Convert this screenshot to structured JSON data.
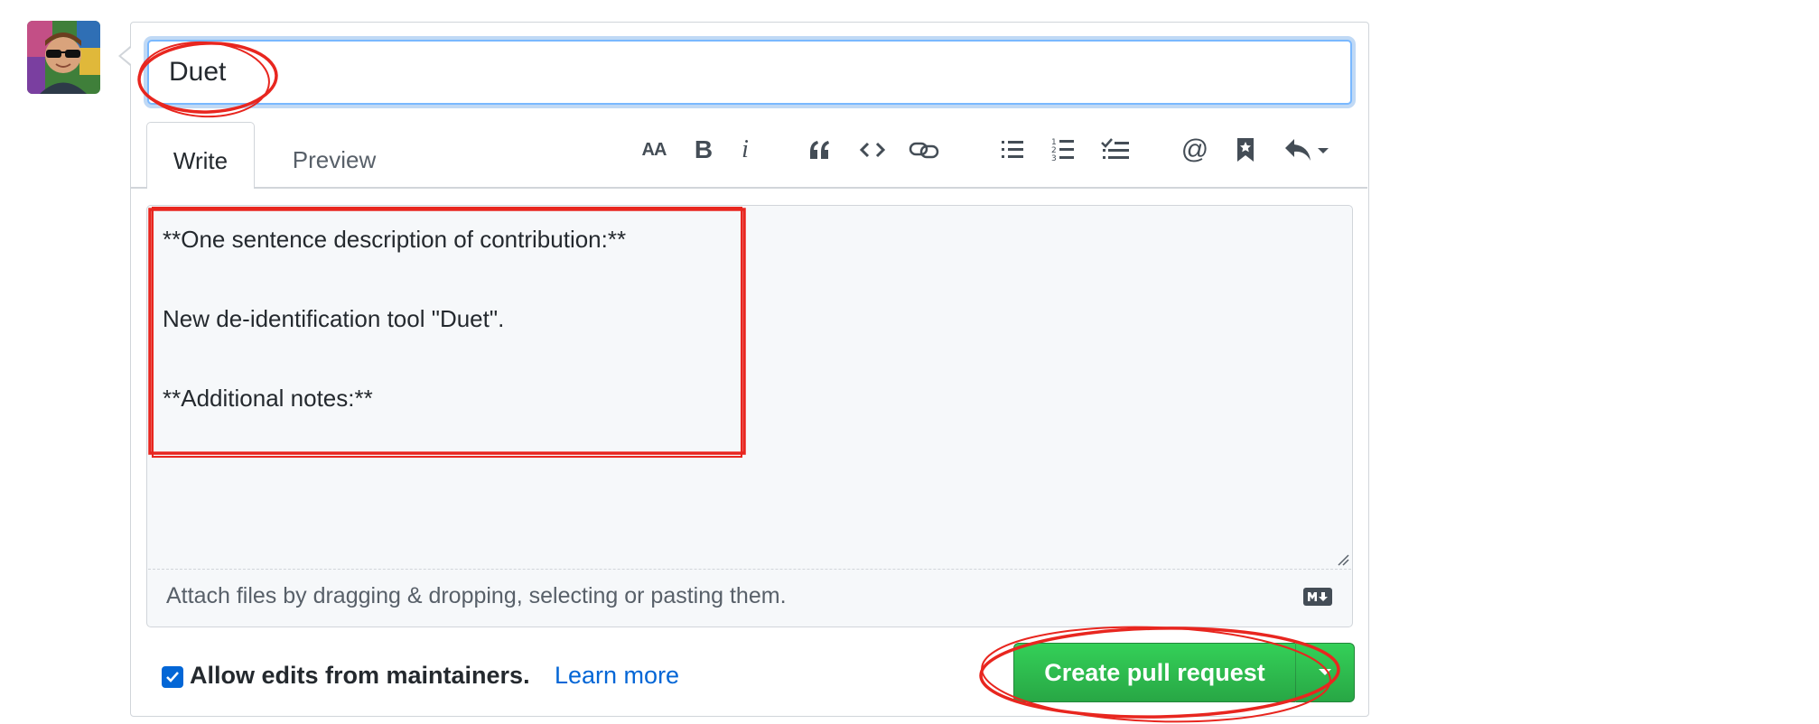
{
  "pull_request_form": {
    "title_value": "Duet",
    "tabs": [
      {
        "label": "Write",
        "selected": true
      },
      {
        "label": "Preview",
        "selected": false
      }
    ],
    "toolbar": {
      "icons": [
        "header-icon",
        "bold-icon",
        "italic-icon",
        "quote-icon",
        "code-icon",
        "link-icon",
        "unordered-list-icon",
        "ordered-list-icon",
        "task-list-icon",
        "mention-icon",
        "reference-icon",
        "reply-icon"
      ],
      "header_glyph": "AA",
      "bold_glyph": "B",
      "italic_glyph": "i",
      "mention_glyph": "@"
    },
    "body_lines": [
      "**One sentence description of contribution:**",
      "",
      "New de-identification tool \"Duet\".",
      "",
      "**Additional notes:**"
    ],
    "attach_hint": "Attach files by dragging & dropping, selecting or pasting them.",
    "allow_edits_checked": true,
    "allow_edits_label": "Allow edits from maintainers.",
    "learn_more_label": "Learn more",
    "submit_label": "Create pull request"
  },
  "colors": {
    "accent_blue": "#0366d6",
    "button_green": "#2ea44f",
    "annotation_red": "#e8261f",
    "border_gray": "#d1d5da"
  }
}
